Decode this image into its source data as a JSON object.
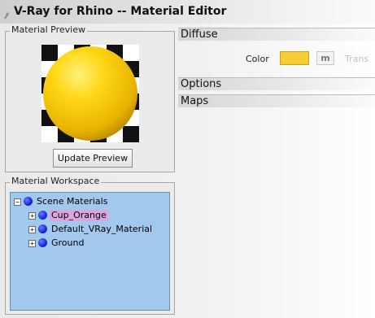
{
  "window": {
    "title": "V-Ray for Rhino -- Material Editor"
  },
  "preview": {
    "group_label": "Material Preview",
    "update_button": "Update Preview"
  },
  "workspace": {
    "group_label": "Material Workspace",
    "root": {
      "label": "Scene Materials",
      "expander": "−"
    },
    "materials": [
      {
        "label": "Cup_Orange",
        "expander": "+",
        "selected": true
      },
      {
        "label": "Default_VRay_Material",
        "expander": "+",
        "selected": false
      },
      {
        "label": "Ground",
        "expander": "+",
        "selected": false
      }
    ]
  },
  "sections": {
    "diffuse": "Diffuse",
    "options": "Options",
    "maps": "Maps"
  },
  "diffuse": {
    "color_label": "Color",
    "color_value": "#f8cc33",
    "map_button": "m",
    "transparency_label": "Trans"
  },
  "colors": {
    "tree_background": "#a3c8ee",
    "selection": "#dba6df",
    "material_node": "#1a2ee0"
  }
}
